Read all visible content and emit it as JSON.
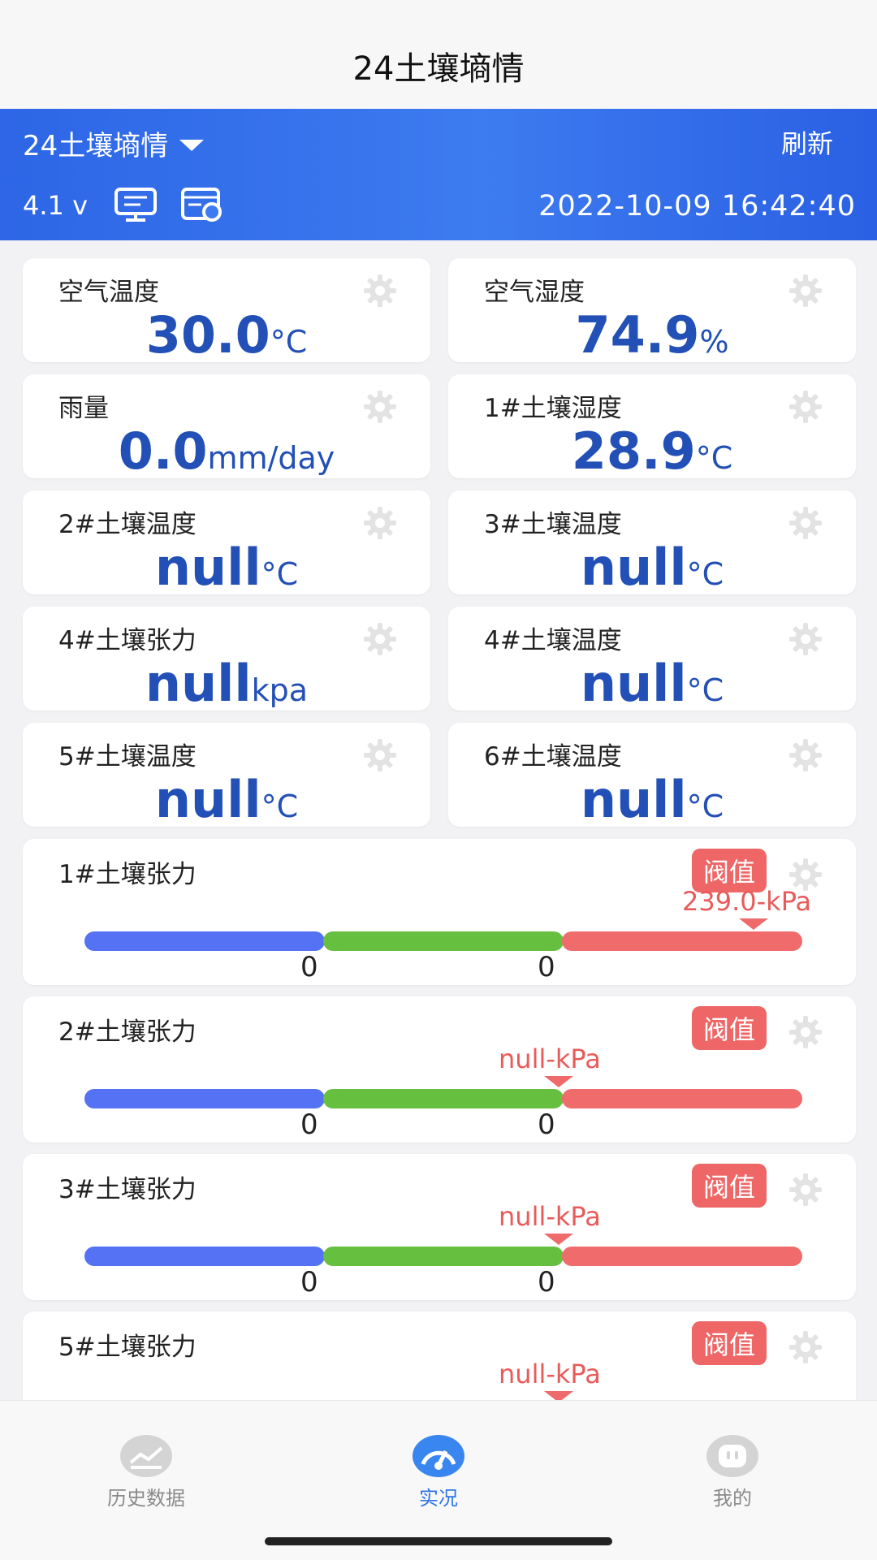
{
  "app": {
    "title": "24土壤墒情"
  },
  "header": {
    "station_name": "24土壤墒情",
    "refresh_label": "刷新",
    "voltage": "4.1 v",
    "datetime": "2022-10-09 16:42:40",
    "icons": [
      "monitor-icon",
      "device-card-icon"
    ],
    "color": "#2d66e6"
  },
  "sensors": [
    {
      "label": "空气温度",
      "value": "30.0",
      "unit": "°C"
    },
    {
      "label": "空气湿度",
      "value": "74.9",
      "unit": "%"
    },
    {
      "label": "雨量",
      "value": "0.0",
      "unit": "mm/day"
    },
    {
      "label": "1#土壤湿度",
      "value": "28.9",
      "unit": "°C"
    },
    {
      "label": "2#土壤温度",
      "value": "null",
      "unit": "°C"
    },
    {
      "label": "3#土壤温度",
      "value": "null",
      "unit": "°C"
    },
    {
      "label": "4#土壤张力",
      "value": "null",
      "unit": "kpa"
    },
    {
      "label": "4#土壤温度",
      "value": "null",
      "unit": "°C"
    },
    {
      "label": "5#土壤温度",
      "value": "null",
      "unit": "°C"
    },
    {
      "label": "6#土壤温度",
      "value": "null",
      "unit": "°C"
    }
  ],
  "tensions": [
    {
      "label": "1#土壤张力",
      "button": "阀值",
      "marker": "239.0-kPa",
      "tick1": "0",
      "tick2": "0"
    },
    {
      "label": "2#土壤张力",
      "button": "阀值",
      "marker": "null-kPa",
      "tick1": "0",
      "tick2": "0"
    },
    {
      "label": "3#土壤张力",
      "button": "阀值",
      "marker": "null-kPa",
      "tick1": "0",
      "tick2": "0"
    },
    {
      "label": "5#土壤张力",
      "button": "阀值",
      "marker": "null-kPa"
    }
  ],
  "nav": [
    {
      "label": "历史数据",
      "icon": "chart-icon",
      "active": false
    },
    {
      "label": "实况",
      "icon": "gauge-icon",
      "active": true
    },
    {
      "label": "我的",
      "icon": "profile-icon",
      "active": false
    }
  ],
  "colors": {
    "value_blue": "#2350b6",
    "threshold_red": "#ee6666",
    "bar_blue": "#5472f3",
    "bar_green": "#66bf3e",
    "bar_red": "#f06c6c",
    "nav_active": "#2f75e6"
  }
}
